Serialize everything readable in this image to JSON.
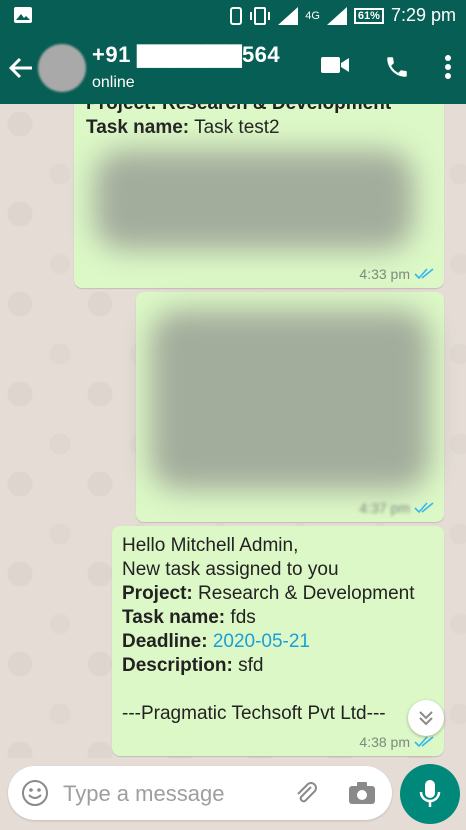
{
  "status_bar": {
    "battery": "61%",
    "network": "4G",
    "time": "7:29 pm"
  },
  "header": {
    "contact_name": "+91 ▇▇▇▇▇▇564",
    "status": "online"
  },
  "messages": [
    {
      "partial_line": "Project: Research & Development",
      "task_line_label": "Task name:",
      "task_line_value": "Task test2",
      "time": "4:33 pm"
    },
    {
      "time": "4:37 pm"
    },
    {
      "greeting": "Hello Mitchell Admin,",
      "line2": "New task assigned to you",
      "project_label": "Project:",
      "project_value": "Research & Development",
      "task_label": "Task name:",
      "task_value": "fds",
      "deadline_label": "Deadline:",
      "deadline_value": "2020-05-21",
      "description_label": "Description:",
      "description_value": "sfd",
      "signature": "---Pragmatic Techsoft Pvt Ltd---",
      "time": "4:38 pm"
    }
  ],
  "composer": {
    "placeholder": "Type a message"
  },
  "icons": [
    "back-arrow-icon",
    "video-call-icon",
    "phone-icon",
    "more-vert-icon",
    "emoji-icon",
    "attach-icon",
    "camera-icon",
    "mic-icon",
    "scroll-down-icon"
  ],
  "colors": {
    "header": "#075e54",
    "bubble": "#dcf8c6",
    "fab": "#00897b",
    "tick": "#34b7f1"
  }
}
